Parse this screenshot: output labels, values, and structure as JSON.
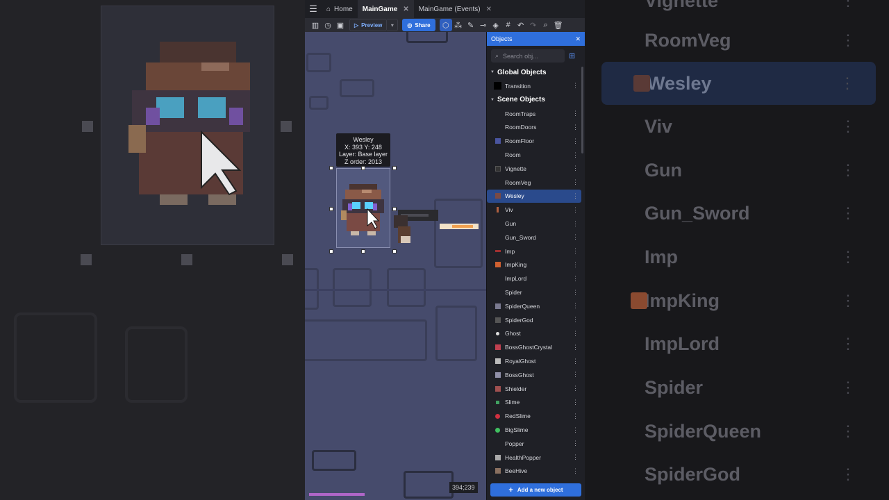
{
  "tabs": [
    {
      "label": "Home",
      "icon": "home-icon"
    },
    {
      "label": "MainGame",
      "active": true
    },
    {
      "label": "MainGame (Events)"
    }
  ],
  "toolbar": {
    "preview_label": "Preview",
    "share_label": "Share"
  },
  "canvas": {
    "tooltip": {
      "name": "Wesley",
      "position": "X: 393  Y: 248",
      "layer": "Layer: Base layer",
      "z_order": "Z order: 2013"
    },
    "coords_readout": "394;239",
    "background_color": "#464b6c"
  },
  "panel": {
    "title": "Objects",
    "search_placeholder": "Search obj...",
    "global_group_label": "Global Objects",
    "scene_group_label": "Scene Objects",
    "global_objects": [
      {
        "name": "Transition",
        "icon": "black-square"
      }
    ],
    "scene_objects": [
      {
        "name": "RoomTraps",
        "icon": "traps"
      },
      {
        "name": "RoomDoors",
        "icon": "doors"
      },
      {
        "name": "RoomFloor",
        "icon": "floor"
      },
      {
        "name": "Room",
        "icon": "room"
      },
      {
        "name": "Vignette",
        "icon": "vignette"
      },
      {
        "name": "RoomVeg",
        "icon": "veg"
      },
      {
        "name": "Wesley",
        "icon": "wesley",
        "selected": true
      },
      {
        "name": "Viv",
        "icon": "viv"
      },
      {
        "name": "Gun",
        "icon": "gun"
      },
      {
        "name": "Gun_Sword",
        "icon": "gun-sword"
      },
      {
        "name": "Imp",
        "icon": "imp"
      },
      {
        "name": "ImpKing",
        "icon": "impking"
      },
      {
        "name": "ImpLord",
        "icon": "implord"
      },
      {
        "name": "Spider",
        "icon": "spider"
      },
      {
        "name": "SpiderQueen",
        "icon": "spiderqueen"
      },
      {
        "name": "SpiderGod",
        "icon": "spidergod"
      },
      {
        "name": "Ghost",
        "icon": "ghost"
      },
      {
        "name": "BossGhostCrystal",
        "icon": "crystal"
      },
      {
        "name": "RoyalGhost",
        "icon": "royalghost"
      },
      {
        "name": "BossGhost",
        "icon": "bossghost"
      },
      {
        "name": "Shielder",
        "icon": "shielder"
      },
      {
        "name": "Slime",
        "icon": "slime"
      },
      {
        "name": "RedSlime",
        "icon": "redslime"
      },
      {
        "name": "BigSlime",
        "icon": "bigslime"
      },
      {
        "name": "Popper",
        "icon": "popper"
      },
      {
        "name": "HealthPopper",
        "icon": "healthpopper"
      },
      {
        "name": "BeeHive",
        "icon": "beehive"
      }
    ],
    "add_button_label": "Add a new object",
    "accent_color": "#2f6fdc"
  },
  "background_right_list": [
    "Vignette",
    "RoomVeg",
    "Wesley",
    "Viv",
    "Gun",
    "Gun_Sword",
    "Imp",
    "ImpKing",
    "ImpLord",
    "Spider",
    "SpiderQueen",
    "SpiderGod"
  ]
}
